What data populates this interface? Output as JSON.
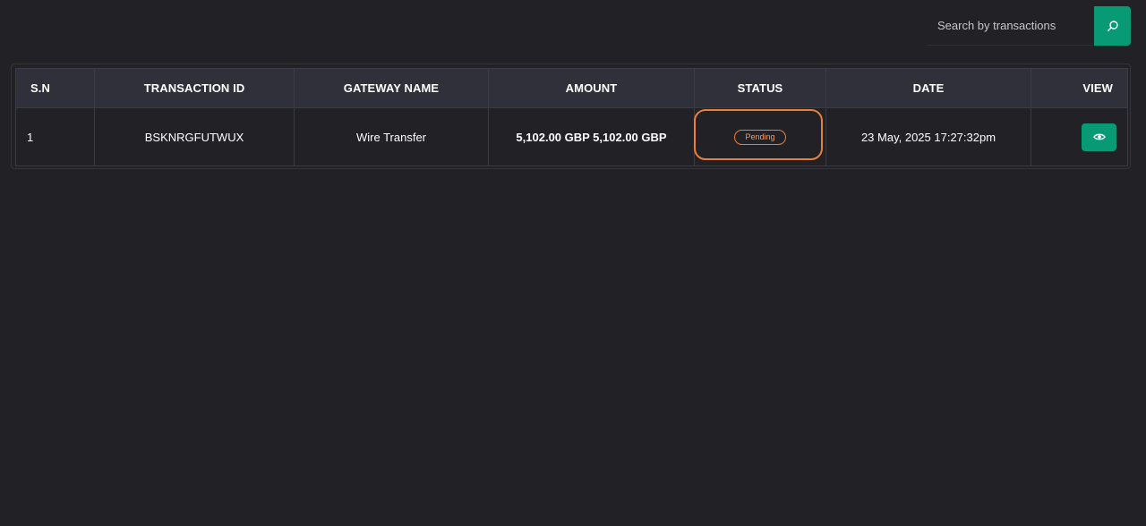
{
  "search": {
    "placeholder": "Search by transactions",
    "button_icon": "search-icon"
  },
  "colors": {
    "background": "#212126",
    "header_row": "#2f3039",
    "accent_green": "#079a74",
    "pending_orange": "#e97f3c"
  },
  "table": {
    "headers": [
      "S.N",
      "TRANSACTION ID",
      "GATEWAY NAME",
      "AMOUNT",
      "STATUS",
      "DATE",
      "VIEW"
    ],
    "rows": [
      {
        "sn": "1",
        "transaction_id": "BSKNRGFUTWUX",
        "gateway": "Wire Transfer",
        "amount": "5,102.00 GBP 5,102.00 GBP",
        "status": "Pending",
        "date": "23 May, 2025 17:27:32pm",
        "view_icon": "eye-icon"
      }
    ]
  }
}
